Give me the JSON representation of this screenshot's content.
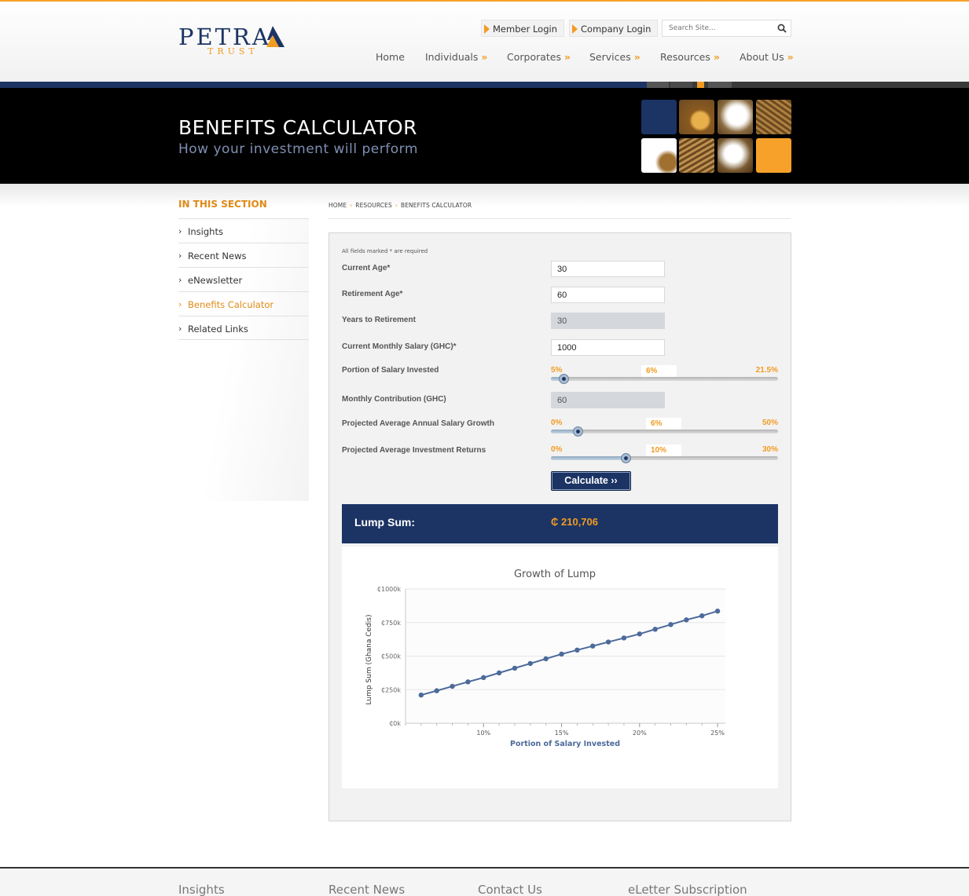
{
  "logo": {
    "name": "PETRA",
    "sub": "TRUST"
  },
  "header": {
    "member_login": "Member Login",
    "company_login": "Company Login",
    "search_placeholder": "Search Site...",
    "nav": [
      {
        "label": "Home",
        "arrow": ""
      },
      {
        "label": "Individuals",
        "arrow": "»"
      },
      {
        "label": "Corporates",
        "arrow": "»"
      },
      {
        "label": "Services",
        "arrow": "»"
      },
      {
        "label": "Resources",
        "arrow": "»"
      },
      {
        "label": "About Us",
        "arrow": "»"
      }
    ]
  },
  "banner": {
    "title": "BENEFITS CALCULATOR",
    "subtitle": "How your investment will perform"
  },
  "sidebar": {
    "heading": "IN THIS SECTION",
    "items": [
      {
        "label": "Insights"
      },
      {
        "label": "Recent News"
      },
      {
        "label": "eNewsletter"
      },
      {
        "label": "Benefits Calculator"
      },
      {
        "label": "Related Links"
      }
    ]
  },
  "breadcrumb": [
    "HOME",
    "RESOURCES",
    "BENEFITS CALCULATOR"
  ],
  "form": {
    "required_note": "All fields marked * are required",
    "current_age": {
      "label": "Current Age*",
      "value": "30"
    },
    "retirement_age": {
      "label": "Retirement Age*",
      "value": "60"
    },
    "years_to_retirement": {
      "label": "Years to Retirement",
      "value": "30"
    },
    "monthly_salary": {
      "label": "Current Monthly Salary (GHC)*",
      "value": "1000"
    },
    "portion_invested": {
      "label": "Portion of Salary Invested",
      "min": "5%",
      "max": "21.5%",
      "value": "6%",
      "level": 0.06
    },
    "monthly_contribution": {
      "label": "Monthly Contribution (GHC)",
      "value": "60"
    },
    "salary_growth": {
      "label": "Projected Average Annual Salary Growth",
      "min": "0%",
      "max": "50%",
      "value": "6%",
      "level": 0.12
    },
    "investment_returns": {
      "label": "Projected Average Investment Returns",
      "min": "0%",
      "max": "30%",
      "value": "10%",
      "level": 0.333
    },
    "calculate_label": "Calculate ››"
  },
  "result": {
    "label": "Lump Sum:",
    "value": "₵ 210,706"
  },
  "chart_data": {
    "type": "line",
    "title": "Growth of Lump",
    "xlabel": "Portion of Salary Invested",
    "ylabel": "Lump Sum (Ghana Cedis)",
    "x": [
      6,
      7,
      8,
      9,
      10,
      11,
      12,
      13,
      14,
      15,
      16,
      17,
      18,
      19,
      20,
      21,
      22,
      23,
      24,
      25
    ],
    "y": [
      210,
      242,
      275,
      308,
      340,
      375,
      410,
      445,
      480,
      515,
      545,
      575,
      605,
      635,
      665,
      700,
      735,
      770,
      800,
      835
    ],
    "xlim": [
      5,
      25.5
    ],
    "ylim": [
      0,
      1000
    ],
    "xticks": [
      10,
      15,
      20,
      25
    ],
    "xtick_labels": [
      "10%",
      "15%",
      "20%",
      "25%"
    ],
    "yticks": [
      0,
      250,
      500,
      750,
      1000
    ],
    "ytick_labels": [
      "₵0k",
      "₵250k",
      "₵500k",
      "₵750k",
      "₵1000k"
    ],
    "line_color": "#4c6a9a",
    "grid": true
  },
  "footer": {
    "columns": [
      "Insights",
      "Recent News",
      "Contact Us",
      "eLetter Subscription"
    ]
  },
  "colors": {
    "navy": "#1c3464",
    "orange": "#f29b22"
  }
}
